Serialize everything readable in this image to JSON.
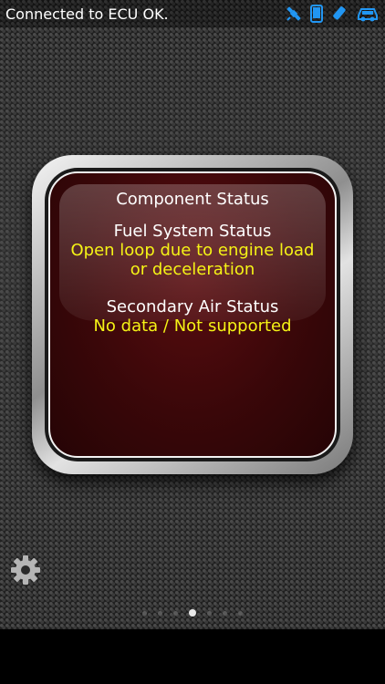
{
  "status_bar": {
    "text": "Connected to ECU OK.",
    "icons": [
      "satellite-icon",
      "phone-icon",
      "bluetooth-icon",
      "car-icon"
    ],
    "icon_color": "#2196f3"
  },
  "gauge": {
    "title": "Component Status",
    "fuel_system_label": "Fuel System Status",
    "fuel_system_value_line1": "Open loop due to engine load",
    "fuel_system_value_line2": "or deceleration",
    "secondary_air_label": "Secondary Air Status",
    "secondary_air_value": "No data / Not supported",
    "label_color": "#ffffff",
    "value_color": "#f5f316"
  },
  "page_indicator": {
    "count": 7,
    "active_index": 3
  },
  "settings_icon": "gear-icon"
}
